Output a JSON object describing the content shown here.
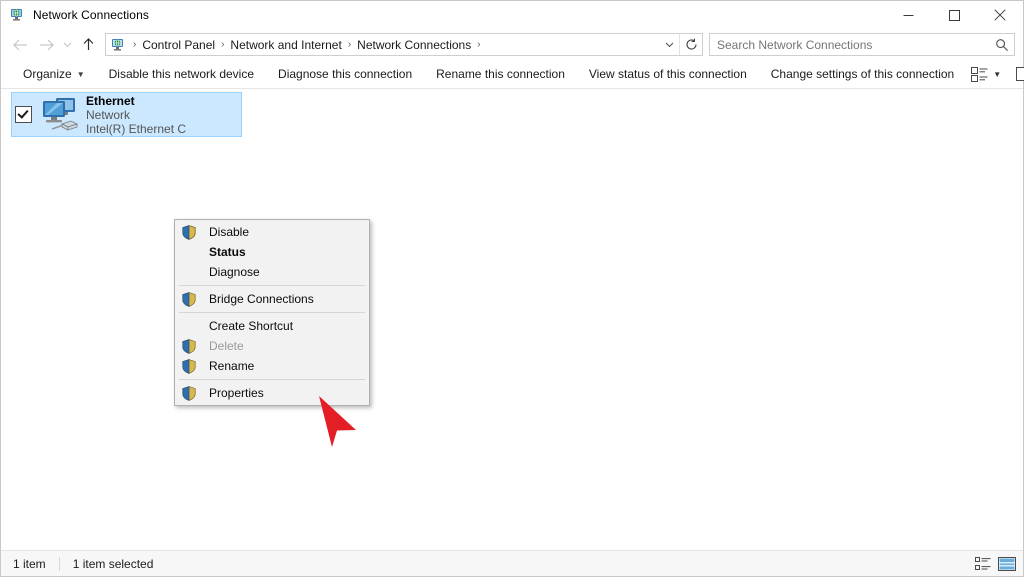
{
  "window": {
    "title": "Network Connections",
    "icon": "network-connections-icon",
    "controls": {
      "minimize": "minimize-button",
      "maximize": "maximize-button",
      "close": "close-button"
    }
  },
  "navigation": {
    "back": "back-arrow",
    "forward": "forward-arrow",
    "recent": "recent-locations-chevron",
    "up": "up-arrow"
  },
  "address": {
    "icon": "control-panel-icon",
    "crumbs": [
      "Control Panel",
      "Network and Internet",
      "Network Connections"
    ],
    "separator": "›",
    "dropdown": "address-dropdown-chevron",
    "refresh": "refresh-icon"
  },
  "search": {
    "placeholder": "Search Network Connections",
    "value": "",
    "icon": "search-icon"
  },
  "toolbar": {
    "organize": "Organize",
    "organize_caret": "▼",
    "items": [
      "Disable this network device",
      "Diagnose this connection",
      "Rename this connection",
      "View status of this connection",
      "Change settings of this connection"
    ],
    "view_options_icon": "view-options-icon",
    "view_caret": "▼",
    "preview_pane_icon": "preview-pane-icon",
    "help_icon": "help-icon"
  },
  "connection": {
    "name": "Ethernet",
    "network": "Network",
    "adapter": "Intel(R) Ethernet C",
    "checked": true,
    "selected": true,
    "icon": "ethernet-adapter-icon"
  },
  "context_menu": {
    "items": [
      {
        "label": "Disable",
        "shield": true,
        "bold": false,
        "disabled": false
      },
      {
        "label": "Status",
        "shield": false,
        "bold": true,
        "disabled": false
      },
      {
        "label": "Diagnose",
        "shield": false,
        "bold": false,
        "disabled": false
      },
      {
        "separator": true
      },
      {
        "label": "Bridge Connections",
        "shield": true,
        "bold": false,
        "disabled": false
      },
      {
        "separator": true
      },
      {
        "label": "Create Shortcut",
        "shield": false,
        "bold": false,
        "disabled": false
      },
      {
        "label": "Delete",
        "shield": true,
        "bold": false,
        "disabled": true
      },
      {
        "label": "Rename",
        "shield": true,
        "bold": false,
        "disabled": false
      },
      {
        "separator": true
      },
      {
        "label": "Properties",
        "shield": true,
        "bold": false,
        "disabled": false
      }
    ]
  },
  "annotation": {
    "pointer": "red-arrow-pointer",
    "color": "#e31e24"
  },
  "statusbar": {
    "item_count": "1 item",
    "selection": "1 item selected",
    "details_view_icon": "details-view-icon",
    "large-icons_view_icon": "large-icons-view-icon"
  },
  "colors": {
    "selection_fill": "#cce8ff",
    "selection_border": "#99d1ff",
    "accent_blue": "#0078d7",
    "arrow_red": "#e31e24"
  }
}
